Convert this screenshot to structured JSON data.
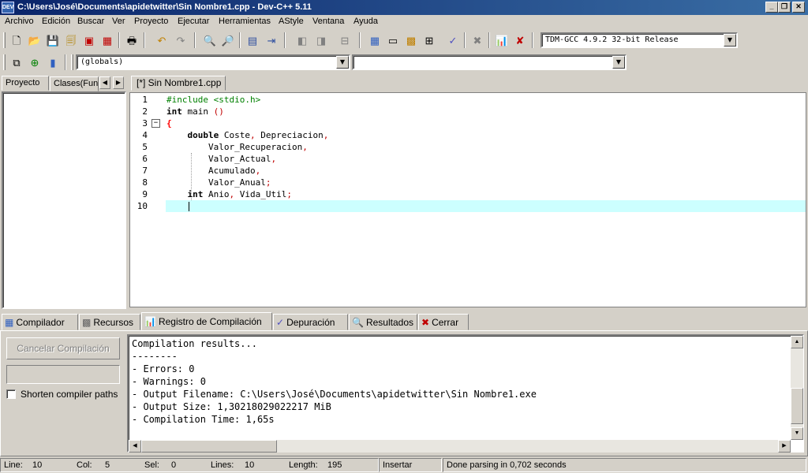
{
  "window": {
    "title": "C:\\Users\\José\\Documents\\apidetwitter\\Sin Nombre1.cpp - Dev-C++ 5.11",
    "app_icon_label": "DEV"
  },
  "menu": [
    "Archivo",
    "Edición",
    "Buscar",
    "Ver",
    "Proyecto",
    "Ejecutar",
    "Herramientas",
    "AStyle",
    "Ventana",
    "Ayuda"
  ],
  "toolbar": {
    "compiler_select": "TDM-GCC 4.9.2 32-bit Release",
    "scope_select": "(globals)",
    "symbol_select": ""
  },
  "left_panel": {
    "tabs": [
      "Proyecto",
      "Clases(Fun"
    ]
  },
  "editor": {
    "tab": "[*] Sin Nombre1.cpp",
    "line_numbers": [
      "1",
      "2",
      "3",
      "4",
      "5",
      "6",
      "7",
      "8",
      "9",
      "10"
    ],
    "fold_marker": "−",
    "lines": [
      [
        {
          "t": "#include <stdio.h>",
          "c": "pp"
        }
      ],
      [
        {
          "t": "int",
          "c": "kw"
        },
        {
          "t": " main "
        },
        {
          "t": "()",
          "c": "pu"
        }
      ],
      [
        {
          "t": "{",
          "c": "br"
        }
      ],
      [
        {
          "t": "    "
        },
        {
          "t": "double",
          "c": "kw"
        },
        {
          "t": " Coste"
        },
        {
          "t": ",",
          "c": "pu"
        },
        {
          "t": " Depreciacion"
        },
        {
          "t": ",",
          "c": "pu"
        }
      ],
      [
        {
          "t": "        Valor_Recuperacion"
        },
        {
          "t": ",",
          "c": "pu"
        }
      ],
      [
        {
          "t": "        Valor_Actual"
        },
        {
          "t": ",",
          "c": "pu"
        }
      ],
      [
        {
          "t": "        Acumulado"
        },
        {
          "t": ",",
          "c": "pu"
        }
      ],
      [
        {
          "t": "        Valor_Anual"
        },
        {
          "t": ";",
          "c": "pu"
        }
      ],
      [
        {
          "t": "    "
        },
        {
          "t": "int",
          "c": "kw"
        },
        {
          "t": " Anio"
        },
        {
          "t": ",",
          "c": "pu"
        },
        {
          "t": " Vida_Util"
        },
        {
          "t": ";",
          "c": "pu"
        }
      ],
      [
        {
          "t": "    "
        }
      ]
    ]
  },
  "bottom_tabs": [
    {
      "label": "Compilador",
      "icon": "grid-icon"
    },
    {
      "label": "Recursos",
      "icon": "resources-icon"
    },
    {
      "label": "Registro de Compilación",
      "icon": "chart-icon"
    },
    {
      "label": "Depuración",
      "icon": "check-icon"
    },
    {
      "label": "Resultados",
      "icon": "search-icon"
    },
    {
      "label": "Cerrar",
      "icon": "close-icon"
    }
  ],
  "compile_panel": {
    "cancel_button": "Cancelar Compilación",
    "shorten_label": "Shorten compiler paths",
    "log": [
      "Compilation results...",
      "--------",
      "- Errors: 0",
      "- Warnings: 0",
      "- Output Filename: C:\\Users\\José\\Documents\\apidetwitter\\Sin Nombre1.exe",
      "- Output Size: 1,30218029022217 MiB",
      "- Compilation Time: 1,65s"
    ]
  },
  "status": {
    "line_label": "Line:",
    "line": "10",
    "col_label": "Col:",
    "col": "5",
    "sel_label": "Sel:",
    "sel": "0",
    "lines_label": "Lines:",
    "lines": "10",
    "length_label": "Length:",
    "length": "195",
    "mode": "Insertar",
    "message": "Done parsing in 0,702 seconds"
  }
}
